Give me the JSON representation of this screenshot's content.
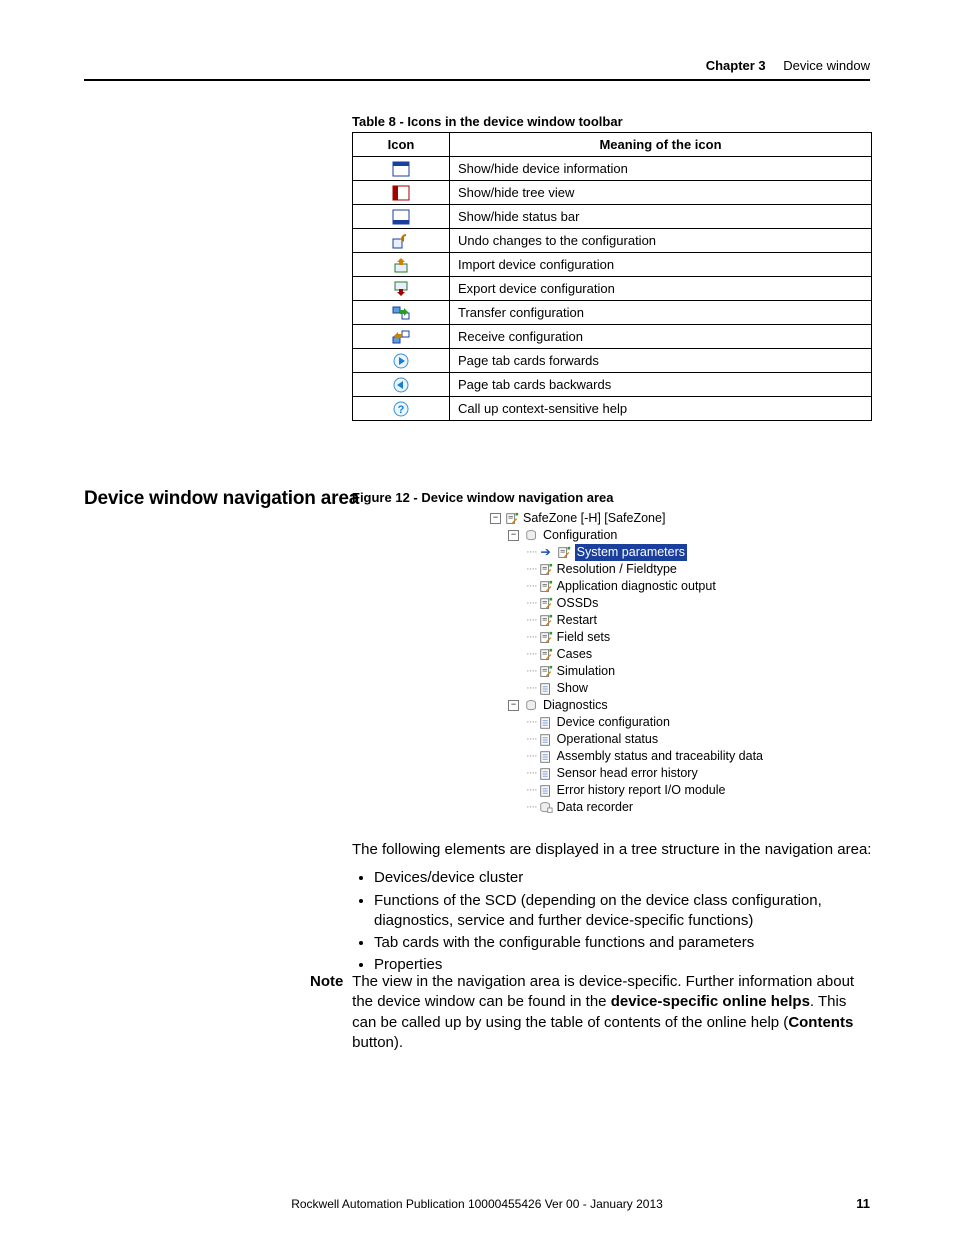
{
  "header": {
    "chapter_label": "Chapter 3",
    "chapter_title": "Device window"
  },
  "table": {
    "caption": "Table 8 - Icons in the device window toolbar",
    "col_icon": "Icon",
    "col_meaning": "Meaning of the icon",
    "rows": [
      {
        "icon_name": "show-device-info-icon",
        "meaning": "Show/hide device information"
      },
      {
        "icon_name": "show-tree-view-icon",
        "meaning": "Show/hide tree view"
      },
      {
        "icon_name": "show-status-bar-icon",
        "meaning": "Show/hide status bar"
      },
      {
        "icon_name": "undo-config-icon",
        "meaning": "Undo changes to the configuration"
      },
      {
        "icon_name": "import-config-icon",
        "meaning": "Import device configuration"
      },
      {
        "icon_name": "export-config-icon",
        "meaning": "Export device configuration"
      },
      {
        "icon_name": "transfer-config-icon",
        "meaning": "Transfer configuration"
      },
      {
        "icon_name": "receive-config-icon",
        "meaning": "Receive configuration"
      },
      {
        "icon_name": "page-forward-icon",
        "meaning": "Page tab cards forwards"
      },
      {
        "icon_name": "page-backward-icon",
        "meaning": "Page tab cards backwards"
      },
      {
        "icon_name": "help-icon",
        "meaning": "Call up context-sensitive help"
      }
    ]
  },
  "section_heading": "Device window navigation area",
  "figure_caption": "Figure 12 - Device window navigation area",
  "tree": {
    "root": "SafeZone [-H] [SafeZone]",
    "config_node": "Configuration",
    "config_children": [
      {
        "label": "System parameters",
        "selected": true,
        "arrow": true
      },
      {
        "label": "Resolution / Fieldtype"
      },
      {
        "label": "Application diagnostic output"
      },
      {
        "label": "OSSDs"
      },
      {
        "label": "Restart"
      },
      {
        "label": "Field sets"
      },
      {
        "label": "Cases"
      },
      {
        "label": "Simulation"
      },
      {
        "label": "Show",
        "plain": true
      }
    ],
    "diag_node": "Diagnostics",
    "diag_children": [
      {
        "label": "Device configuration"
      },
      {
        "label": "Operational status"
      },
      {
        "label": "Assembly status and traceability data"
      },
      {
        "label": "Sensor head error history"
      },
      {
        "label": "Error history report I/O module"
      },
      {
        "label": "Data recorder",
        "recorder": true
      }
    ]
  },
  "body": {
    "intro": "The following elements are displayed in a tree structure in the navigation area:",
    "bullets": [
      "Devices/device cluster",
      "Functions of the SCD (depending on the device class configuration, diagnostics, service and further device-specific functions)",
      "Tab cards with the configurable functions and parameters",
      "Properties"
    ]
  },
  "note": {
    "label": "Note",
    "text_pre": "The view in the navigation area is device-specific. Further information about the device window can be found in the ",
    "bold1": "device-specific online helps",
    "text_mid": ". This can be called up by using the table of contents of the online help (",
    "bold2": "Contents",
    "text_post": " button)."
  },
  "footer": {
    "publication": "Rockwell Automation Publication 10000455426 Ver 00 - January 2013",
    "page": "11"
  }
}
